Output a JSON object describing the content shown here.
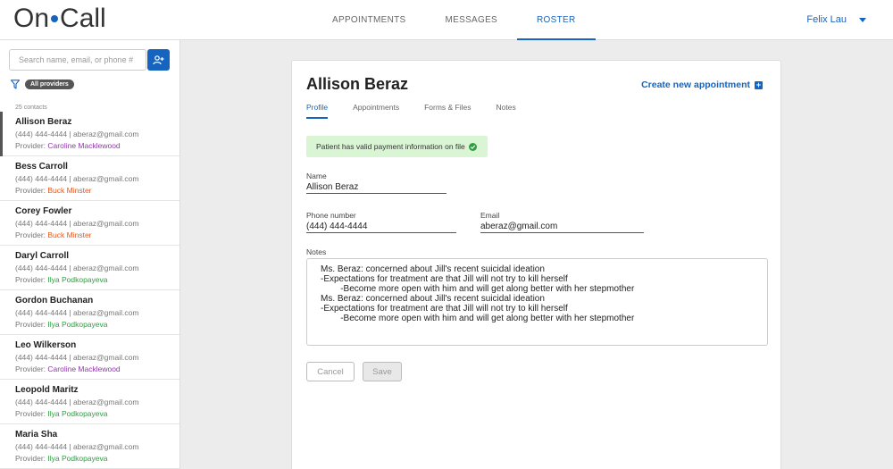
{
  "header": {
    "logo_left": "On",
    "logo_right": "Call",
    "tabs": [
      {
        "label": "APPOINTMENTS"
      },
      {
        "label": "MESSAGES"
      },
      {
        "label": "ROSTER"
      }
    ],
    "active_tab": "ROSTER",
    "user_name": "Felix Lau"
  },
  "sidebar": {
    "search_placeholder": "Search name, email, or phone #",
    "filter_badge": "All providers",
    "contact_count": "25 contacts",
    "contacts": [
      {
        "name": "Allison Beraz",
        "info": "(444) 444-4444 | aberaz@gmail.com",
        "provider_prefix": "Provider:",
        "provider": "Caroline Macklewood",
        "provider_color": "#8e3aa8",
        "selected": true
      },
      {
        "name": "Bess Carroll",
        "info": "(444) 444-4444 | aberaz@gmail.com",
        "provider_prefix": "Provider:",
        "provider": "Buck Minster",
        "provider_color": "#e8561c"
      },
      {
        "name": "Corey Fowler",
        "info": "(444) 444-4444 | aberaz@gmail.com",
        "provider_prefix": "Provider:",
        "provider": "Buck Minster",
        "provider_color": "#e8561c"
      },
      {
        "name": "Daryl Carroll",
        "info": "(444) 444-4444 | aberaz@gmail.com",
        "provider_prefix": "Provider:",
        "provider": "Ilya Podkopayeva",
        "provider_color": "#2e9e3f"
      },
      {
        "name": "Gordon Buchanan",
        "info": "(444) 444-4444 | aberaz@gmail.com",
        "provider_prefix": "Provider:",
        "provider": "Ilya Podkopayeva",
        "provider_color": "#2e9e3f"
      },
      {
        "name": "Leo Wilkerson",
        "info": "(444) 444-4444 | aberaz@gmail.com",
        "provider_prefix": "Provider:",
        "provider": "Caroline Macklewood",
        "provider_color": "#8e3aa8"
      },
      {
        "name": "Leopold Maritz",
        "info": "(444) 444-4444 | aberaz@gmail.com",
        "provider_prefix": "Provider:",
        "provider": "Ilya Podkopayeva",
        "provider_color": "#2e9e3f"
      },
      {
        "name": "Maria Sha",
        "info": "(444) 444-4444 | aberaz@gmail.com",
        "provider_prefix": "Provider:",
        "provider": "Ilya Podkopayeva",
        "provider_color": "#2e9e3f"
      }
    ]
  },
  "profile": {
    "patient_name": "Allison Beraz",
    "create_appointment_label": "Create new appointment",
    "tabs": [
      {
        "label": "Profile"
      },
      {
        "label": "Appointments"
      },
      {
        "label": "Forms & Files"
      },
      {
        "label": "Notes"
      }
    ],
    "active_tab": "Profile",
    "payment_alert": "Patient has valid payment information on file",
    "name_label": "Name",
    "name_value": "Allison Beraz",
    "phone_label": "Phone number",
    "phone_value": "(444) 444-4444",
    "email_label": "Email",
    "email_value": "aberaz@gmail.com",
    "notes_label": "Notes",
    "notes_value": "Ms. Beraz: concerned about Jill's recent suicidal ideation\n-Expectations for treatment are that Jill will not try to kill herself\n        -Become more open with him and will get along better with her stepmother\nMs. Beraz: concerned about Jill's recent suicidal ideation\n-Expectations for treatment are that Jill will not try to kill herself\n        -Become more open with him and will get along better with her stepmother",
    "cancel_label": "Cancel",
    "save_label": "Save"
  },
  "colors": {
    "accent": "#1565c0",
    "success_bg": "#d9f5d4",
    "success_icon": "#2e9e3f"
  }
}
